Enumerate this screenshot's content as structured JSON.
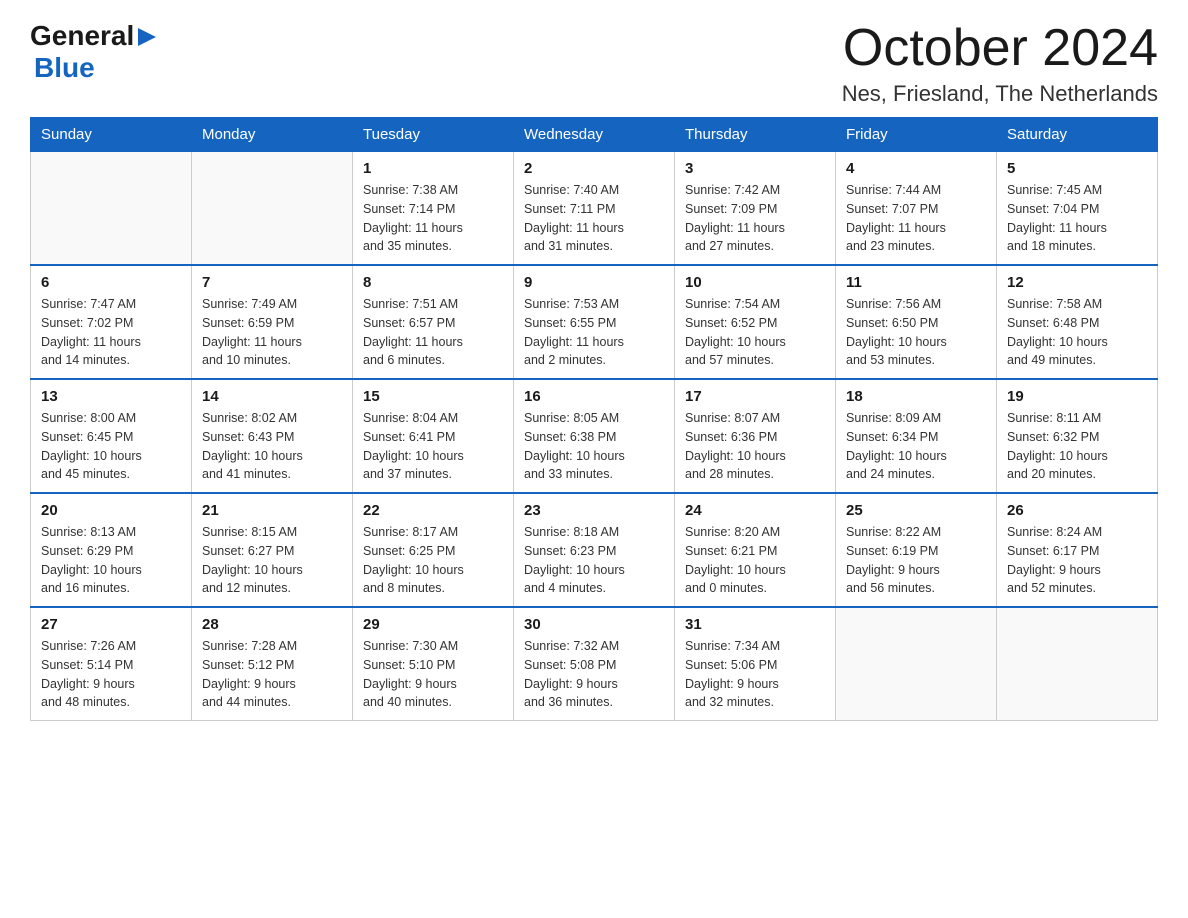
{
  "logo": {
    "general": "General",
    "blue": "Blue",
    "arrow": "▶"
  },
  "title": "October 2024",
  "subtitle": "Nes, Friesland, The Netherlands",
  "days_header": [
    "Sunday",
    "Monday",
    "Tuesday",
    "Wednesday",
    "Thursday",
    "Friday",
    "Saturday"
  ],
  "weeks": [
    [
      {
        "day": "",
        "info": ""
      },
      {
        "day": "",
        "info": ""
      },
      {
        "day": "1",
        "info": "Sunrise: 7:38 AM\nSunset: 7:14 PM\nDaylight: 11 hours\nand 35 minutes."
      },
      {
        "day": "2",
        "info": "Sunrise: 7:40 AM\nSunset: 7:11 PM\nDaylight: 11 hours\nand 31 minutes."
      },
      {
        "day": "3",
        "info": "Sunrise: 7:42 AM\nSunset: 7:09 PM\nDaylight: 11 hours\nand 27 minutes."
      },
      {
        "day": "4",
        "info": "Sunrise: 7:44 AM\nSunset: 7:07 PM\nDaylight: 11 hours\nand 23 minutes."
      },
      {
        "day": "5",
        "info": "Sunrise: 7:45 AM\nSunset: 7:04 PM\nDaylight: 11 hours\nand 18 minutes."
      }
    ],
    [
      {
        "day": "6",
        "info": "Sunrise: 7:47 AM\nSunset: 7:02 PM\nDaylight: 11 hours\nand 14 minutes."
      },
      {
        "day": "7",
        "info": "Sunrise: 7:49 AM\nSunset: 6:59 PM\nDaylight: 11 hours\nand 10 minutes."
      },
      {
        "day": "8",
        "info": "Sunrise: 7:51 AM\nSunset: 6:57 PM\nDaylight: 11 hours\nand 6 minutes."
      },
      {
        "day": "9",
        "info": "Sunrise: 7:53 AM\nSunset: 6:55 PM\nDaylight: 11 hours\nand 2 minutes."
      },
      {
        "day": "10",
        "info": "Sunrise: 7:54 AM\nSunset: 6:52 PM\nDaylight: 10 hours\nand 57 minutes."
      },
      {
        "day": "11",
        "info": "Sunrise: 7:56 AM\nSunset: 6:50 PM\nDaylight: 10 hours\nand 53 minutes."
      },
      {
        "day": "12",
        "info": "Sunrise: 7:58 AM\nSunset: 6:48 PM\nDaylight: 10 hours\nand 49 minutes."
      }
    ],
    [
      {
        "day": "13",
        "info": "Sunrise: 8:00 AM\nSunset: 6:45 PM\nDaylight: 10 hours\nand 45 minutes."
      },
      {
        "day": "14",
        "info": "Sunrise: 8:02 AM\nSunset: 6:43 PM\nDaylight: 10 hours\nand 41 minutes."
      },
      {
        "day": "15",
        "info": "Sunrise: 8:04 AM\nSunset: 6:41 PM\nDaylight: 10 hours\nand 37 minutes."
      },
      {
        "day": "16",
        "info": "Sunrise: 8:05 AM\nSunset: 6:38 PM\nDaylight: 10 hours\nand 33 minutes."
      },
      {
        "day": "17",
        "info": "Sunrise: 8:07 AM\nSunset: 6:36 PM\nDaylight: 10 hours\nand 28 minutes."
      },
      {
        "day": "18",
        "info": "Sunrise: 8:09 AM\nSunset: 6:34 PM\nDaylight: 10 hours\nand 24 minutes."
      },
      {
        "day": "19",
        "info": "Sunrise: 8:11 AM\nSunset: 6:32 PM\nDaylight: 10 hours\nand 20 minutes."
      }
    ],
    [
      {
        "day": "20",
        "info": "Sunrise: 8:13 AM\nSunset: 6:29 PM\nDaylight: 10 hours\nand 16 minutes."
      },
      {
        "day": "21",
        "info": "Sunrise: 8:15 AM\nSunset: 6:27 PM\nDaylight: 10 hours\nand 12 minutes."
      },
      {
        "day": "22",
        "info": "Sunrise: 8:17 AM\nSunset: 6:25 PM\nDaylight: 10 hours\nand 8 minutes."
      },
      {
        "day": "23",
        "info": "Sunrise: 8:18 AM\nSunset: 6:23 PM\nDaylight: 10 hours\nand 4 minutes."
      },
      {
        "day": "24",
        "info": "Sunrise: 8:20 AM\nSunset: 6:21 PM\nDaylight: 10 hours\nand 0 minutes."
      },
      {
        "day": "25",
        "info": "Sunrise: 8:22 AM\nSunset: 6:19 PM\nDaylight: 9 hours\nand 56 minutes."
      },
      {
        "day": "26",
        "info": "Sunrise: 8:24 AM\nSunset: 6:17 PM\nDaylight: 9 hours\nand 52 minutes."
      }
    ],
    [
      {
        "day": "27",
        "info": "Sunrise: 7:26 AM\nSunset: 5:14 PM\nDaylight: 9 hours\nand 48 minutes."
      },
      {
        "day": "28",
        "info": "Sunrise: 7:28 AM\nSunset: 5:12 PM\nDaylight: 9 hours\nand 44 minutes."
      },
      {
        "day": "29",
        "info": "Sunrise: 7:30 AM\nSunset: 5:10 PM\nDaylight: 9 hours\nand 40 minutes."
      },
      {
        "day": "30",
        "info": "Sunrise: 7:32 AM\nSunset: 5:08 PM\nDaylight: 9 hours\nand 36 minutes."
      },
      {
        "day": "31",
        "info": "Sunrise: 7:34 AM\nSunset: 5:06 PM\nDaylight: 9 hours\nand 32 minutes."
      },
      {
        "day": "",
        "info": ""
      },
      {
        "day": "",
        "info": ""
      }
    ]
  ]
}
